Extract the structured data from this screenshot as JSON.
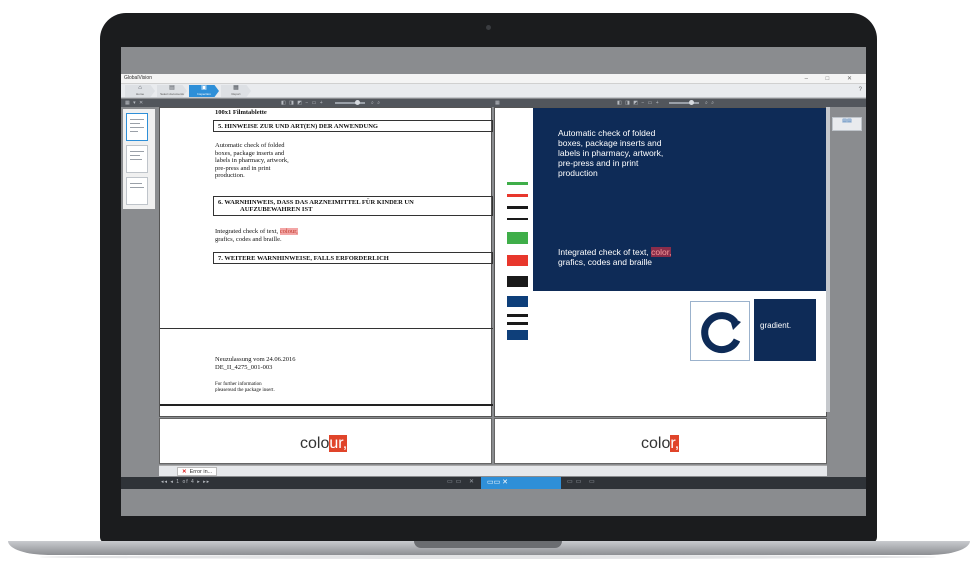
{
  "app": {
    "title": "GlobalVision",
    "window_controls": "– □ ✕"
  },
  "toolbar": {
    "steps": [
      {
        "icon": "⌂",
        "label": "Home"
      },
      {
        "icon": "▤",
        "label": "Select documents"
      },
      {
        "icon": "▣",
        "label": "Inspection"
      },
      {
        "icon": "▦",
        "label": "Report"
      }
    ],
    "help_icon": "?"
  },
  "document": {
    "top_line": "100x1 Filmtablette",
    "section5": "5.    HINWEISE ZUR UND ART(EN) DER ANWENDUNG",
    "para1": [
      "Automatic check of folded",
      "boxes, package inserts and",
      "labels in pharmacy, artwork,",
      "pre-press and in print",
      "production."
    ],
    "section6_line1": "6.    WARNHINWEIS, DASS DAS ARZNEIMITTEL FÜR KINDER UN",
    "section6_line2": "AUFZUBEWAHREN IST",
    "para2_a": "Integrated check of text,",
    "para2_hl": "colour,",
    "para2_b": "grafics, codes and braille.",
    "section7": "7.    WEITERE WARNHINWEISE, FALLS ERFORDERLICH",
    "footer1": "Neuzulassung vom 24.06.2016",
    "footer2": "DE_II_4275_001-003",
    "footer3": "For further information",
    "footer4": "pleaseread the package insert."
  },
  "artwork": {
    "text1": [
      "Automatic check of folded",
      "boxes, package inserts and",
      "labels in pharmacy, artwork,",
      "pre-press and in print",
      "production"
    ],
    "text2_a": "Integrated check of text,",
    "text2_hl": "color,",
    "text2_b": "grafics, codes and braille",
    "logo_name": "gradient.",
    "bar_colors": [
      "#3fae49",
      "#e8372c",
      "#1a1a1a",
      "#3fae49",
      "#e8372c",
      "#1a1a1a",
      "#0e3f7a",
      "#1a1a1a",
      "#0e3f7a"
    ]
  },
  "compare": {
    "left_plain": "colo",
    "left_mark": "ur,",
    "right_plain": "colo",
    "right_mark": "r,"
  },
  "tabs": [
    {
      "label": "Error in..."
    }
  ],
  "status": {
    "nav": "◂◂ ◂  1 of 4  ▸ ▸▸",
    "views": "▭▭  ✕"
  },
  "colors": {
    "accent": "#2e8fd8",
    "artwork_blue": "#0e2b57",
    "highlight": "#e0442a"
  }
}
